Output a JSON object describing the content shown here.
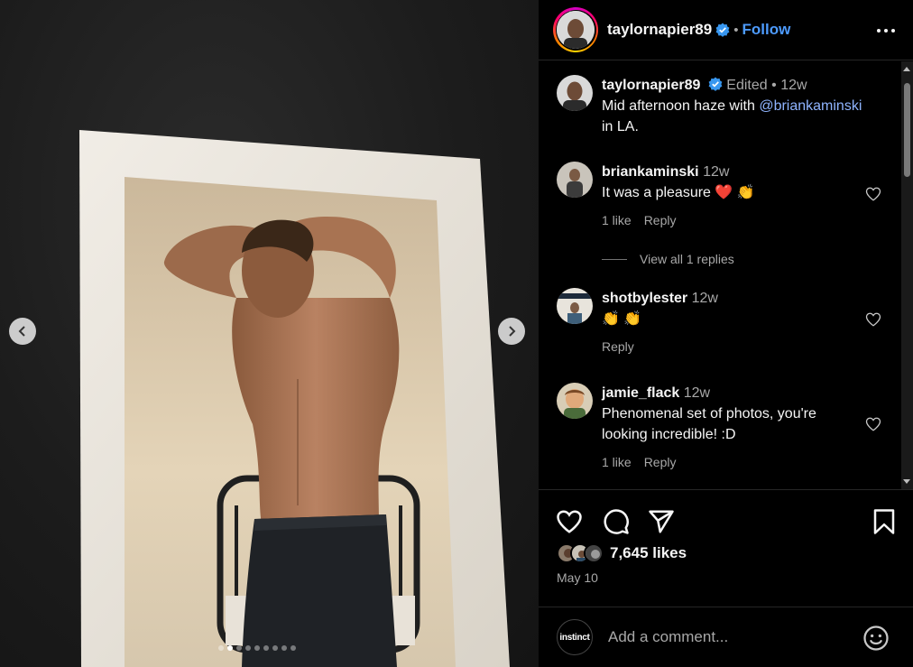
{
  "post": {
    "carousel": {
      "total_slides": 9,
      "active_index": 1
    }
  },
  "header": {
    "username": "taylornapier89",
    "separator": "•",
    "follow_label": "Follow"
  },
  "caption": {
    "username": "taylornapier89",
    "edited": "Edited",
    "separator": "•",
    "time": "12w",
    "text_before": "Mid afternoon haze with",
    "mention": "@briankaminski",
    "text_after": "in LA."
  },
  "comments": [
    {
      "username": "briankaminski",
      "time": "12w",
      "text": "It was a pleasure ❤️ 👏",
      "likes": "1 like",
      "reply_label": "Reply"
    },
    {
      "username": "shotbylester",
      "time": "12w",
      "text": "👏 👏",
      "reply_label": "Reply"
    },
    {
      "username": "jamie_flack",
      "time": "12w",
      "text": "Phenomenal set of photos, you're looking incredible! :D",
      "likes": "1 like",
      "reply_label": "Reply"
    }
  ],
  "view_replies": "View all 1 replies",
  "likes_count": "7,645 likes",
  "date": "May 10",
  "comment_box": {
    "avatar_text": "instinct",
    "placeholder": "Add a comment..."
  },
  "colors": {
    "accent": "#4d9bff",
    "verified": "#3897f0",
    "background": "#000000"
  }
}
